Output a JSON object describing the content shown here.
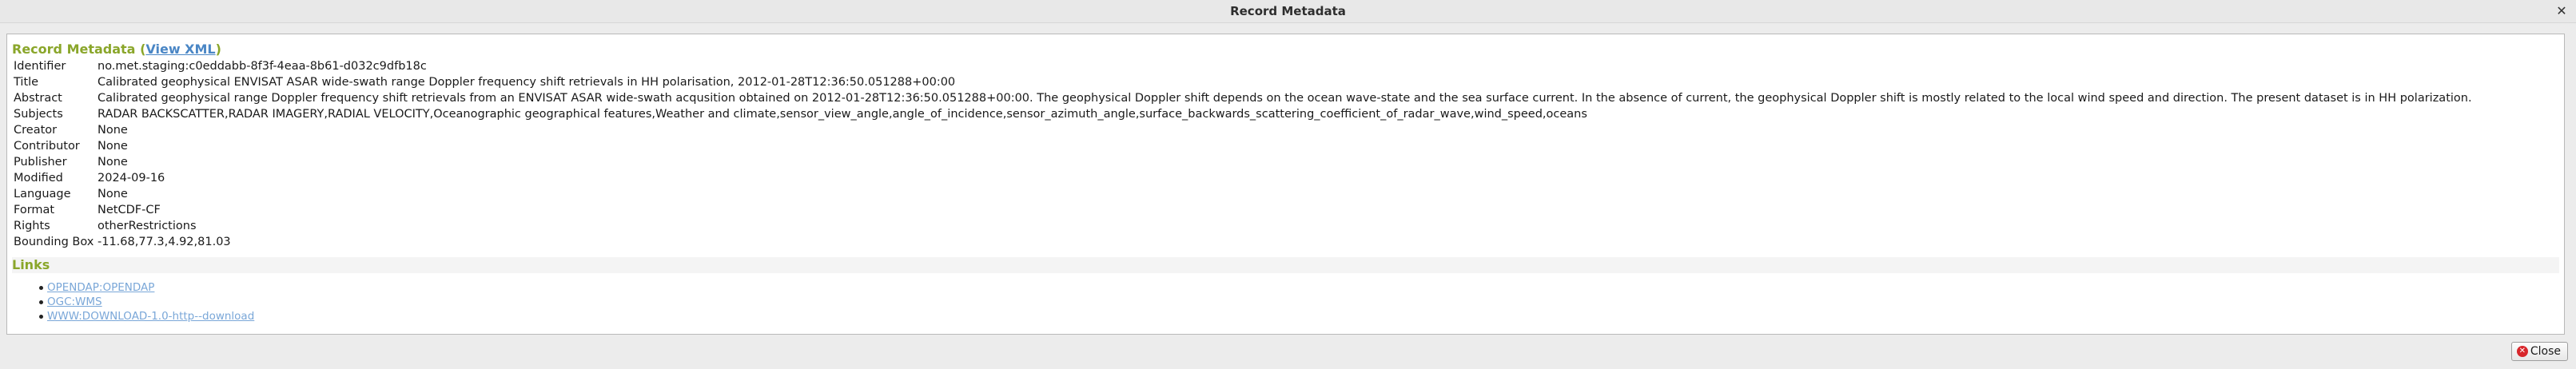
{
  "window": {
    "title": "Record Metadata",
    "close_glyph": "✕"
  },
  "record": {
    "heading": "Record Metadata",
    "view_xml_label": "View XML",
    "fields": [
      {
        "key": "Identifier",
        "value": "no.met.staging:c0eddabb-8f3f-4eaa-8b61-d032c9dfb18c"
      },
      {
        "key": "Title",
        "value": "Calibrated geophysical ENVISAT ASAR wide-swath range Doppler frequency shift retrievals in HH polarisation, 2012-01-28T12:36:50.051288+00:00"
      },
      {
        "key": "Abstract",
        "value": "Calibrated geophysical range Doppler frequency shift retrievals from an ENVISAT ASAR wide-swath acqusition obtained on 2012-01-28T12:36:50.051288+00:00. The geophysical Doppler shift depends on the ocean wave-state and the sea surface current. In the absence of current, the geophysical Doppler shift is mostly related to the local wind speed and direction. The present dataset is in HH polarization."
      },
      {
        "key": "Subjects",
        "value": "RADAR BACKSCATTER,RADAR IMAGERY,RADIAL VELOCITY,Oceanographic geographical features,Weather and climate,sensor_view_angle,angle_of_incidence,sensor_azimuth_angle,surface_backwards_scattering_coefficient_of_radar_wave,wind_speed,oceans"
      },
      {
        "key": "Creator",
        "value": "None"
      },
      {
        "key": "Contributor",
        "value": "None"
      },
      {
        "key": "Publisher",
        "value": "None"
      },
      {
        "key": "Modified",
        "value": "2024-09-16"
      },
      {
        "key": "Language",
        "value": "None"
      },
      {
        "key": "Format",
        "value": "NetCDF-CF"
      },
      {
        "key": "Rights",
        "value": "otherRestrictions"
      },
      {
        "key": "Bounding Box",
        "value": "-11.68,77.3,4.92,81.03"
      }
    ]
  },
  "links": {
    "heading": "Links",
    "items": [
      {
        "label": "OPENDAP:OPENDAP"
      },
      {
        "label": "OGC:WMS"
      },
      {
        "label": "WWW:DOWNLOAD-1.0-http--download"
      }
    ]
  },
  "footer": {
    "close_label": "Close",
    "close_icon": "close-circle-icon"
  },
  "colors": {
    "section_heading": "#8aa62a",
    "link": "#4a86c5",
    "close_icon_bg": "#d8262b"
  }
}
